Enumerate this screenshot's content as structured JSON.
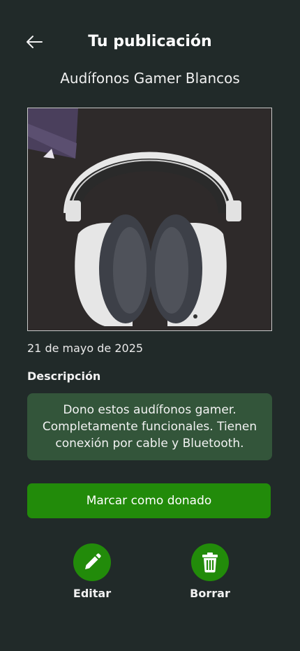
{
  "header": {
    "title": "Tu publicación",
    "back_icon": "arrow-left-icon"
  },
  "item": {
    "title": "Audífonos Gamer Blancos",
    "date": "21 de mayo de 2025",
    "description_label": "Descripción",
    "description": "Dono estos audífonos gamer. Completamente funcionales. Tienen conexión por cable y Bluetooth."
  },
  "actions": {
    "donate_label": "Marcar como donado",
    "edit_label": "Editar",
    "edit_icon": "pencil-icon",
    "delete_label": "Borrar",
    "delete_icon": "trash-icon"
  },
  "colors": {
    "background": "#212a29",
    "accent": "#228b0a",
    "description_bg": "#33553a"
  }
}
